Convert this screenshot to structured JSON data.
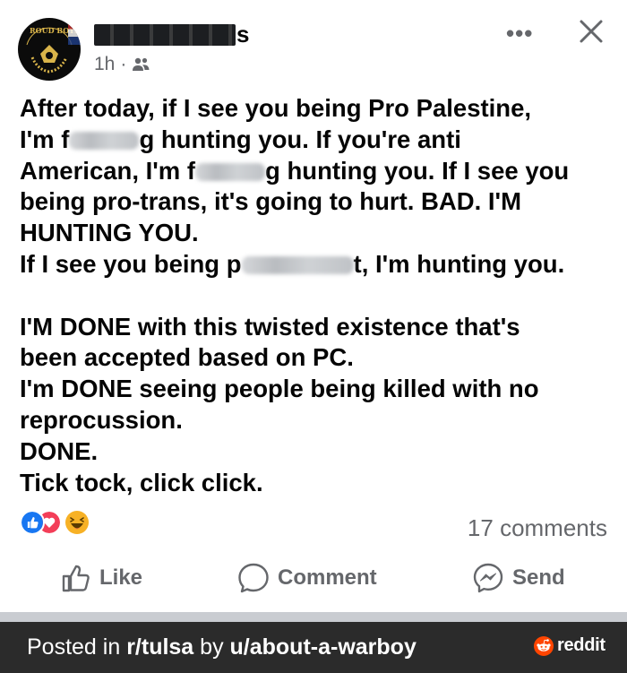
{
  "post": {
    "author_visible_suffix": "s",
    "time": "1h",
    "audience_icon": "friends-icon",
    "more_label": "•••",
    "text_lines": [
      [
        "After today, if I see you being Pro Palestine,"
      ],
      [
        "I'm f",
        "",
        "g hunting you. If you're anti"
      ],
      [
        "American, I'm f",
        "",
        "g hunting you. If I see you"
      ],
      [
        "being pro-trans, it's going to hurt. BAD. I'M"
      ],
      [
        "HUNTING YOU."
      ],
      [
        "If I see you being p",
        "",
        "t, I'm hunting you."
      ],
      [
        ""
      ],
      [
        "I'M DONE with this twisted existence that's"
      ],
      [
        "been accepted based on PC."
      ],
      [
        "I'm DONE seeing people being killed with no"
      ],
      [
        "reprocussion."
      ],
      [
        "DONE."
      ],
      [
        "Tick tock, click click."
      ]
    ],
    "reactions": [
      "like-reaction-icon",
      "love-reaction-icon",
      "haha-reaction-icon"
    ],
    "comments_count": "17 comments",
    "actions": {
      "like": "Like",
      "comment": "Comment",
      "send": "Send"
    }
  },
  "footer": {
    "posted_prefix": "Posted in ",
    "subreddit": "r/tulsa",
    "by": " by ",
    "user": "u/about-a-warboy",
    "brand": "reddit"
  },
  "colors": {
    "text": "#050505",
    "secondary": "#65676b",
    "like_blue": "#1877f2",
    "love_red": "#f33e58",
    "haha_yellow": "#f7b125",
    "footer_bg": "#2b2b2b",
    "reddit_orange": "#ff4500"
  }
}
